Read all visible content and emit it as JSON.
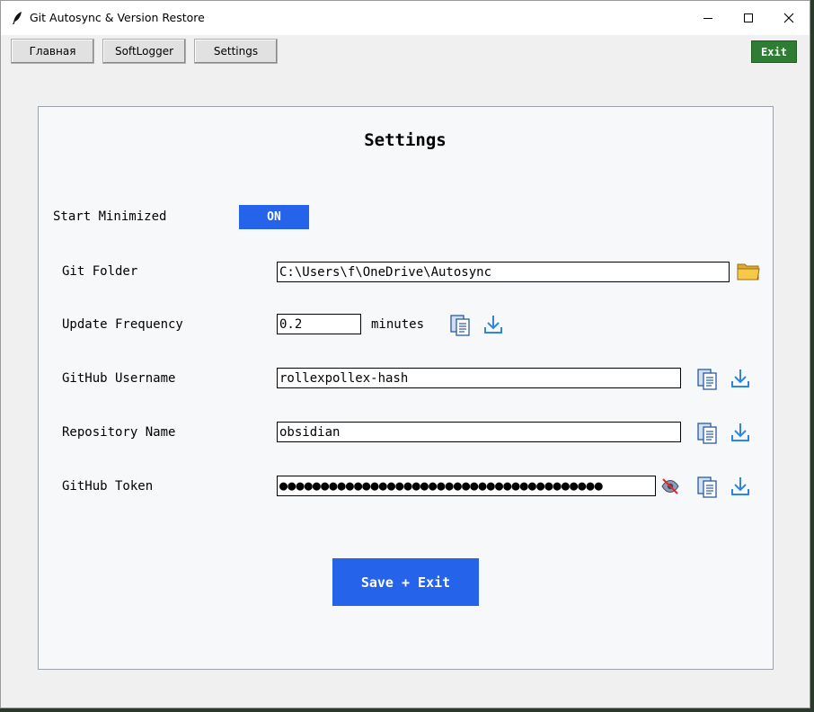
{
  "window": {
    "title": "Git Autosync & Version Restore",
    "controls": [
      "minimize-icon",
      "maximize-icon",
      "close-icon"
    ]
  },
  "toolbar": {
    "tabs": [
      {
        "label": "Главная"
      },
      {
        "label": "SoftLogger"
      },
      {
        "label": "Settings"
      }
    ],
    "exit_label": "Exit",
    "exit_color": "#2e7d32"
  },
  "settings": {
    "title": "Settings",
    "start_minimized": {
      "label": "Start Minimized",
      "toggle_label": "ON",
      "color": "#2563eb"
    },
    "git_folder": {
      "label": "Git Folder",
      "value": "C:\\Users\\f\\OneDrive\\Autosync",
      "icon": "folder-icon"
    },
    "update_frequency": {
      "label": "Update Frequency",
      "value": "0.2",
      "unit": "minutes"
    },
    "github_username": {
      "label": "GitHub Username",
      "value": "rollexpollex-hash"
    },
    "repository_name": {
      "label": "Repository Name",
      "value": "obsidian"
    },
    "github_token": {
      "label": "GitHub Token",
      "masked_value": "●●●●●●●●●●●●●●●●●●●●●●●●●●●●●●●●●●●●●●●",
      "icon": "eye-off-icon"
    },
    "row_icons": [
      "paste-icon",
      "download-icon"
    ],
    "save_label": "Save + Exit"
  }
}
